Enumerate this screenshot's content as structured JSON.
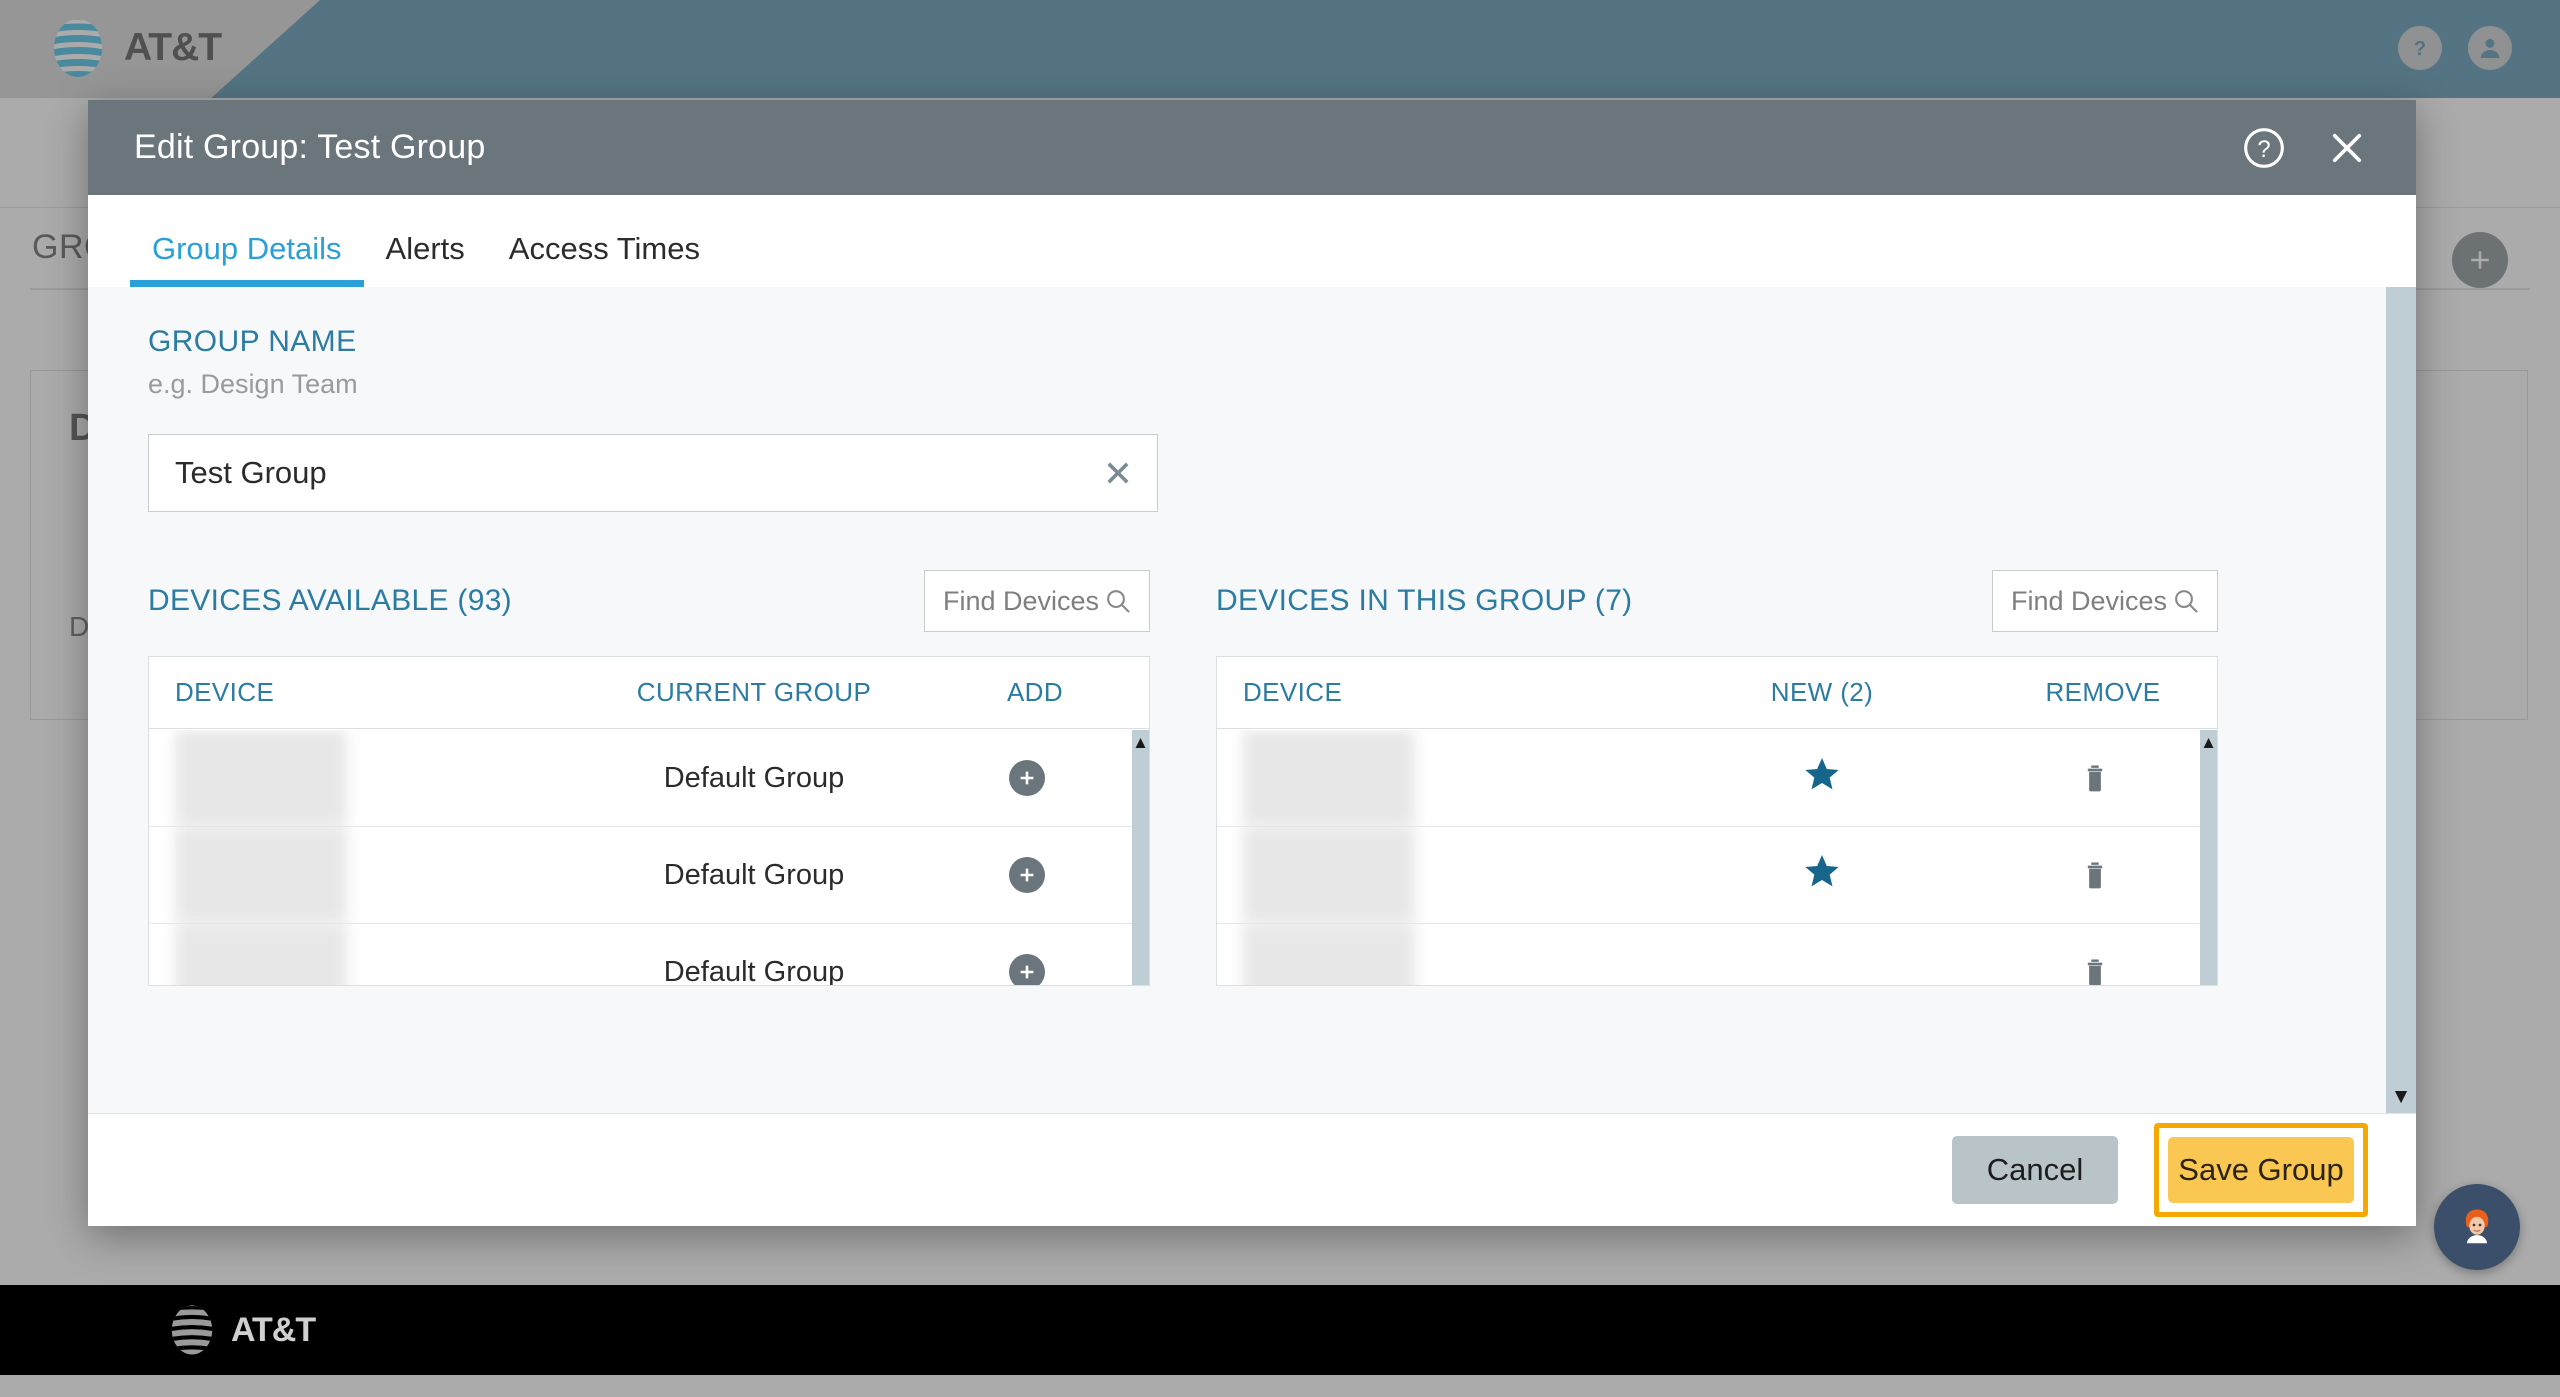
{
  "topbar": {
    "brand": "AT&T",
    "help_icon": "help-circle-icon",
    "account_icon": "account-circle-icon"
  },
  "background_page": {
    "title": "GROUPS",
    "add_button_icon": "plus-icon",
    "card_title": "D",
    "card_text": "De"
  },
  "modal": {
    "title": "Edit Group: Test Group",
    "help_icon": "help-circle-icon",
    "close_icon": "close-icon",
    "tabs": [
      {
        "label": "Group Details",
        "active": true
      },
      {
        "label": "Alerts",
        "active": false
      },
      {
        "label": "Access Times",
        "active": false
      }
    ],
    "group_name": {
      "label": "GROUP NAME",
      "hint": "e.g. Design Team",
      "value": "Test Group",
      "placeholder": "e.g. Design Team",
      "clear_icon": "clear-x-icon"
    },
    "available_panel": {
      "title": "DEVICES AVAILABLE (93)",
      "search_placeholder": "Find Devices",
      "search_value": "",
      "search_icon": "search-icon",
      "columns": [
        "DEVICE",
        "CURRENT GROUP",
        "ADD"
      ],
      "rows": [
        {
          "device": "",
          "current_group": "Default Group",
          "action_icon": "plus-circle-icon"
        },
        {
          "device": "",
          "current_group": "Default Group",
          "action_icon": "plus-circle-icon"
        },
        {
          "device": "",
          "current_group": "Default Group",
          "action_icon": "plus-circle-icon"
        }
      ]
    },
    "group_panel": {
      "title": "DEVICES IN THIS GROUP (7)",
      "search_placeholder": "Find Devices",
      "search_value": "",
      "search_icon": "search-icon",
      "columns": [
        "DEVICE",
        "NEW (2)",
        "REMOVE"
      ],
      "rows": [
        {
          "device": "",
          "is_new": true,
          "action_icon": "trash-icon"
        },
        {
          "device": "",
          "is_new": true,
          "action_icon": "trash-icon"
        },
        {
          "device": "",
          "is_new": false,
          "action_icon": "trash-icon"
        }
      ]
    },
    "footer": {
      "cancel_label": "Cancel",
      "save_label": "Save Group"
    }
  },
  "footer": {
    "brand": "AT&T"
  },
  "chat": {
    "icon": "agent-avatar-icon"
  },
  "colors": {
    "brand_blue": "#1c6e96",
    "accent_blue": "#2a9fd8",
    "link_blue": "#2c7ba3",
    "modal_header_grey": "#6b767c",
    "save_yellow": "#fac752",
    "highlight_orange": "#f5a800",
    "star_blue": "#16668b"
  }
}
